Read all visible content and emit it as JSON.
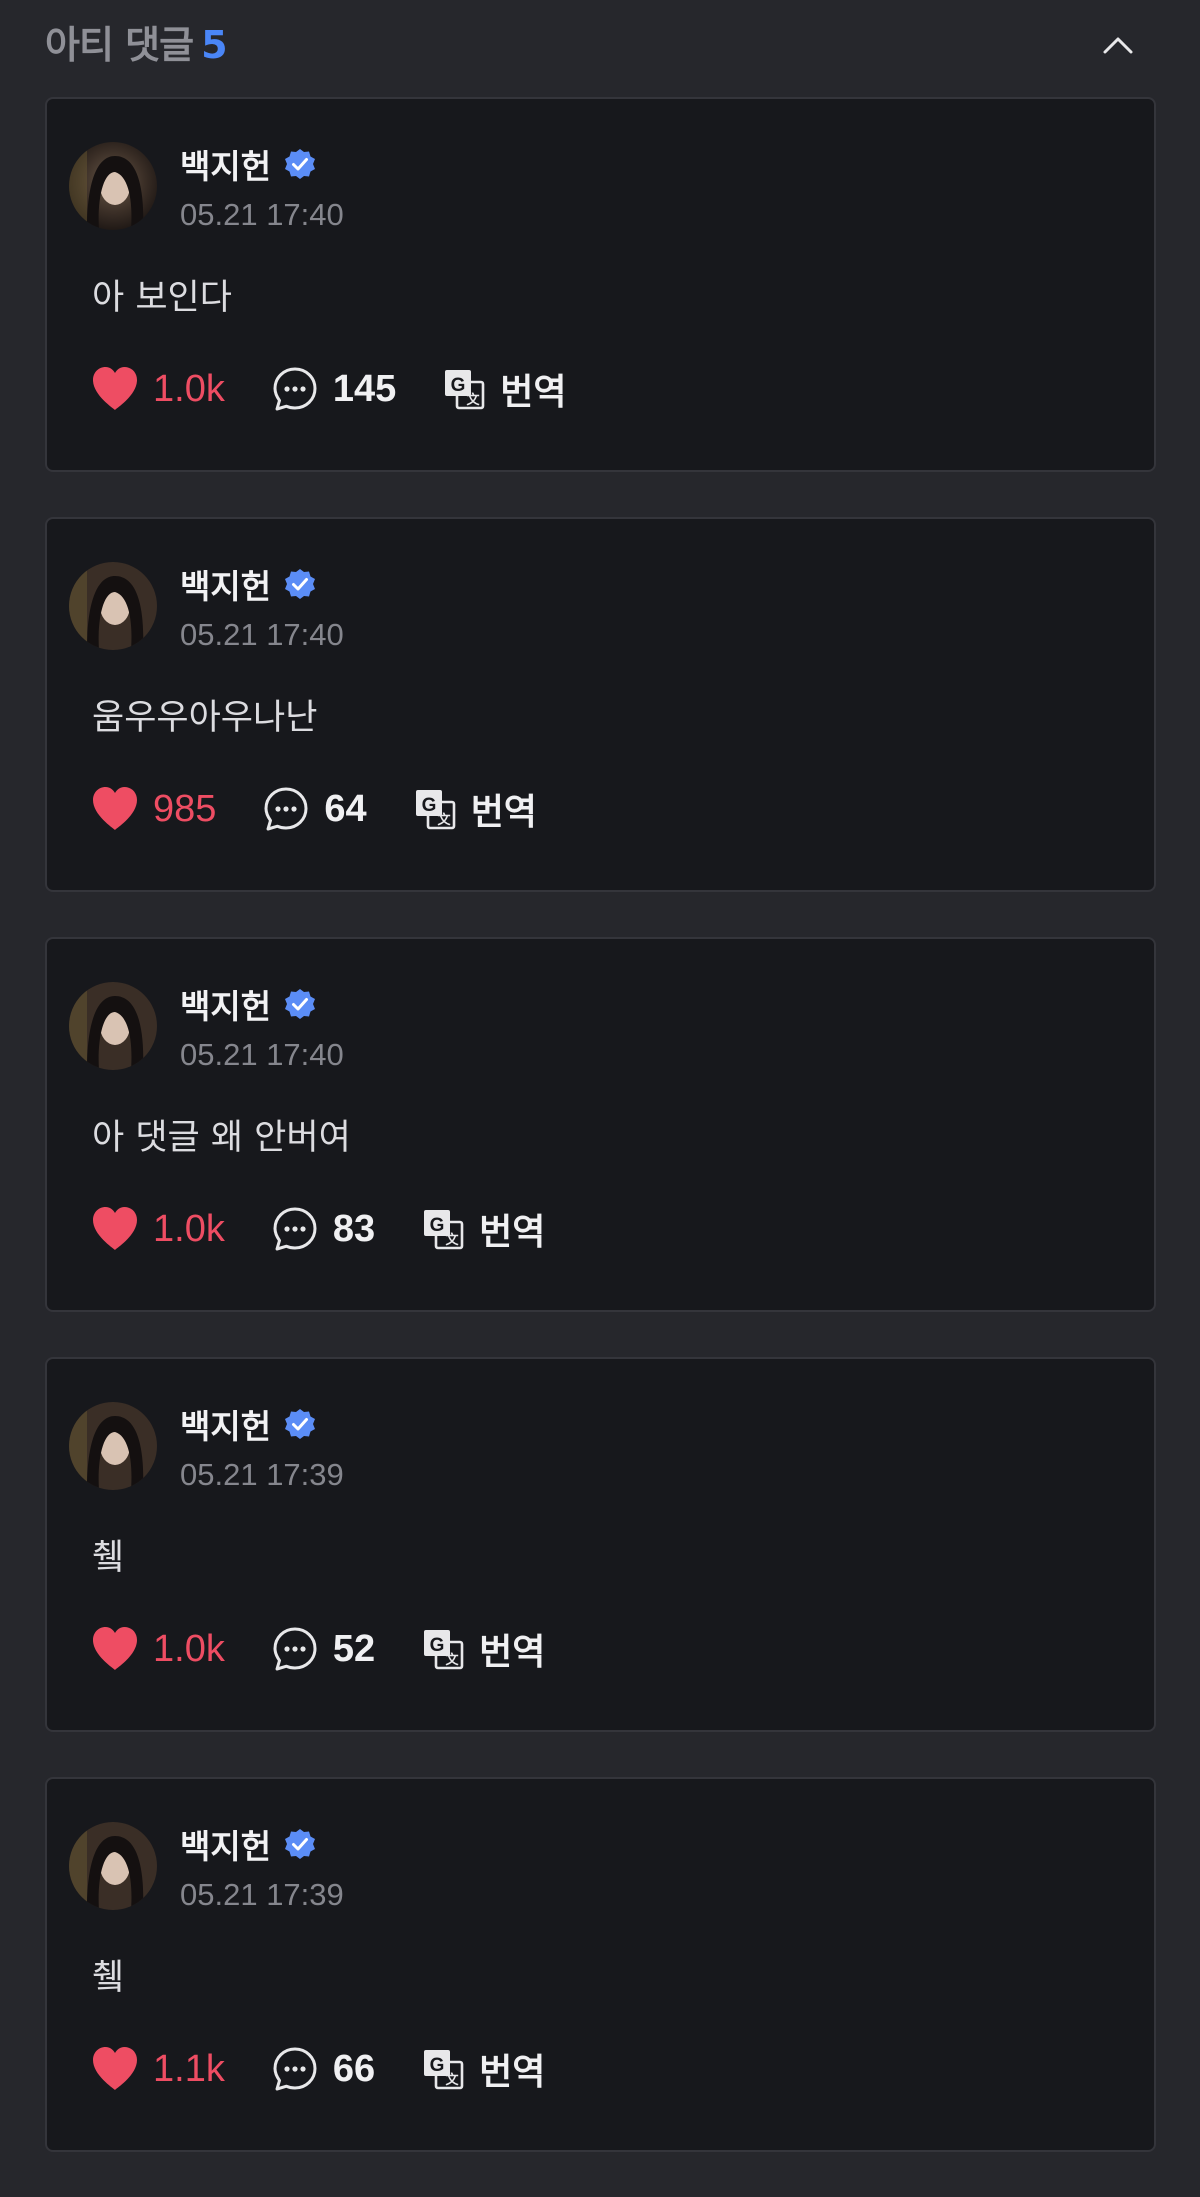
{
  "header": {
    "title": "아티 댓글",
    "count": "5"
  },
  "colors": {
    "background": "#26272c",
    "card": "#17181c",
    "accent_blue": "#4a86f7",
    "like_red": "#ee4d63"
  },
  "icons": {
    "collapse": "chevron-up-icon",
    "verified": "verified-badge-icon",
    "like": "heart-icon",
    "reply": "speech-bubble-icon",
    "translate": "translate-icon"
  },
  "comments": [
    {
      "author": "백지헌",
      "timestamp": "05.21 17:40",
      "text": "아 보인다",
      "likes": "1.0k",
      "replies": "145",
      "translate_label": "번역"
    },
    {
      "author": "백지헌",
      "timestamp": "05.21 17:40",
      "text": "움우우아우나난",
      "likes": "985",
      "replies": "64",
      "translate_label": "번역"
    },
    {
      "author": "백지헌",
      "timestamp": "05.21 17:40",
      "text": "아 댓글 왜 안버여",
      "likes": "1.0k",
      "replies": "83",
      "translate_label": "번역"
    },
    {
      "author": "백지헌",
      "timestamp": "05.21 17:39",
      "text": "췤",
      "likes": "1.0k",
      "replies": "52",
      "translate_label": "번역"
    },
    {
      "author": "백지헌",
      "timestamp": "05.21 17:39",
      "text": "췤",
      "likes": "1.1k",
      "replies": "66",
      "translate_label": "번역"
    }
  ]
}
